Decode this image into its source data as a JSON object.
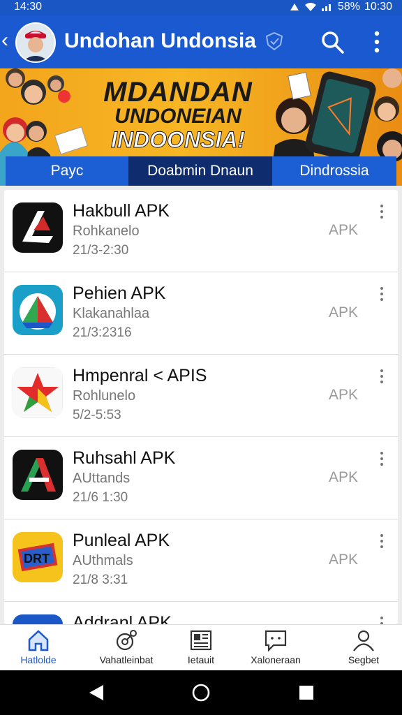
{
  "status_bar": {
    "time_left": "14:30",
    "battery": "58%",
    "time_right": "10:30"
  },
  "header": {
    "title": "Undohan Undonsia"
  },
  "banner": {
    "line1": "MDANDAN",
    "line2": "UNDONEIAN",
    "line3": "INDOONSIA!"
  },
  "tabs": [
    {
      "label": "Payc",
      "active": false
    },
    {
      "label": "Doabmin Dnaun",
      "active": true
    },
    {
      "label": "Dindrossia",
      "active": false
    }
  ],
  "apps": [
    {
      "name": "Hakbull APK",
      "developer": "Rohkanelo",
      "version": "21/3-2:30",
      "badge": "APK",
      "icon": "arrow-logo-dark"
    },
    {
      "name": "Pehien APK",
      "developer": "Klakanahlaa",
      "version": "21/3:2316",
      "badge": "APK",
      "icon": "triangle-logo-teal"
    },
    {
      "name": "Hmpenral < APIS",
      "developer": "Rohlunelo",
      "version": "5/2-5:53",
      "badge": "APK",
      "icon": "star-logo"
    },
    {
      "name": "Ruhsahl APK",
      "developer": "AUttands",
      "version": "21/6 1:30",
      "badge": "APK",
      "icon": "a-logo-green-red"
    },
    {
      "name": "Punleal APK",
      "developer": "AUthmals",
      "version": "21/8 3:31",
      "badge": "APK",
      "icon": "drt-logo-yellow"
    },
    {
      "name": "Addranl APK",
      "developer": "",
      "version": "",
      "badge": "",
      "icon": "blue-logo"
    }
  ],
  "bottom_nav": [
    {
      "label": "Hatlolde",
      "icon": "home-icon",
      "active": true
    },
    {
      "label": "Vahatleinbat",
      "icon": "satellite-icon",
      "active": false
    },
    {
      "label": "Ietauit",
      "icon": "news-icon",
      "active": false
    },
    {
      "label": "Xaloneraan",
      "icon": "chat-icon",
      "active": false
    },
    {
      "label": "Segbet",
      "icon": "profile-icon",
      "active": false
    }
  ],
  "colors": {
    "primary": "#1a59d0",
    "tab_active": "#0f2c6e",
    "banner": "#f3a51c"
  }
}
